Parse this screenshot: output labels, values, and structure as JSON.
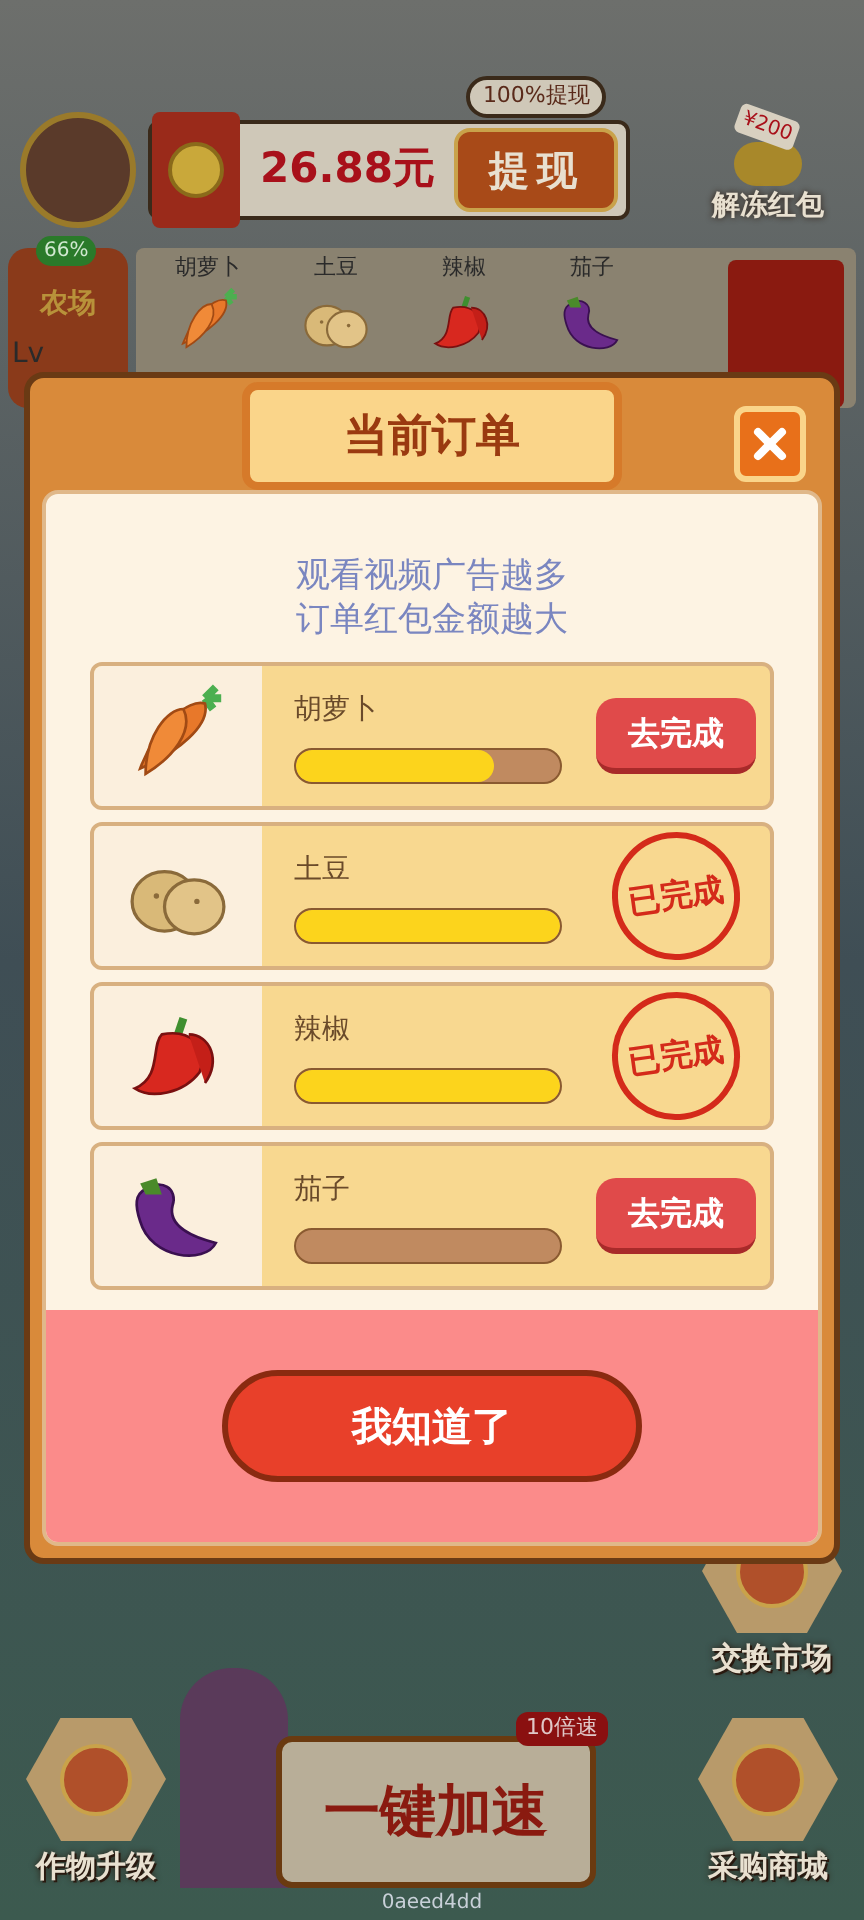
{
  "hud": {
    "balance": "26.88元",
    "withdraw_button": "提现",
    "withdraw_badge": "100%提现",
    "unfreeze": {
      "label": "解冻红包",
      "amount": "¥200"
    }
  },
  "farm": {
    "progress": "66%",
    "title": "农场",
    "level_label": "Lv"
  },
  "crops": [
    {
      "kind": "carrot",
      "name": "胡萝卜"
    },
    {
      "kind": "potato",
      "name": "土豆"
    },
    {
      "kind": "pepper",
      "name": "辣椒"
    },
    {
      "kind": "eggplant",
      "name": "茄子"
    }
  ],
  "dialog": {
    "title": "当前订单",
    "hint_lines": [
      "观看视频广告越多",
      "订单红包金额越大"
    ],
    "orders": [
      {
        "kind": "carrot",
        "name": "胡萝卜",
        "level": 0.75,
        "done": false,
        "action": "去完成"
      },
      {
        "kind": "potato",
        "name": "土豆",
        "level": 1,
        "done": true,
        "action": "已完成"
      },
      {
        "kind": "pepper",
        "name": "辣椒",
        "level": 1,
        "done": true,
        "action": "已完成"
      },
      {
        "kind": "eggplant",
        "name": "茄子",
        "level": 0,
        "done": false,
        "action": "去完成"
      }
    ],
    "confirm_button": "我知道了"
  },
  "bottom": {
    "market": "交换市场",
    "upgrade": "作物升级",
    "boost_button": "一键加速",
    "boost_badge": "10倍速",
    "shop": "采购商城",
    "user_id": "0aeed4dd"
  }
}
